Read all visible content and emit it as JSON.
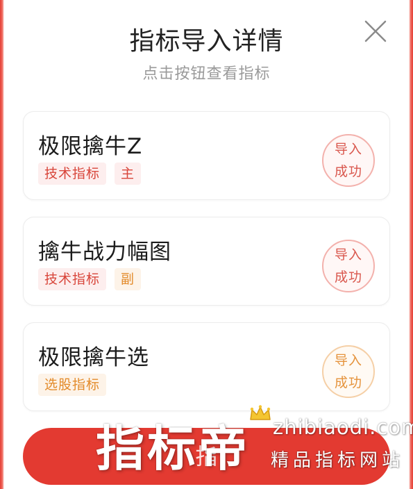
{
  "modal": {
    "title": "指标导入详情",
    "subtitle": "点击按钮查看指标",
    "close_icon": "close-icon"
  },
  "indicators": [
    {
      "name": "极限擒牛Z",
      "tags": [
        "技术指标",
        "主"
      ],
      "tag_colors": [
        "red",
        "red"
      ],
      "status_line1": "导入",
      "status_line2": "成功",
      "status_color": "red"
    },
    {
      "name": "擒牛战力幅图",
      "tags": [
        "技术指标",
        "副"
      ],
      "tag_colors": [
        "red",
        "orange"
      ],
      "status_line1": "导入",
      "status_line2": "成功",
      "status_color": "red"
    },
    {
      "name": "极限擒牛选",
      "tags": [
        "选股指标"
      ],
      "tag_colors": [
        "orange"
      ],
      "status_line1": "导入",
      "status_line2": "成功",
      "status_color": "orange"
    }
  ],
  "bottom_button": {
    "label": "指"
  },
  "watermark": {
    "brand": "指标帝",
    "site": "zhibiaodi.com",
    "slogan": "精品指标网站",
    "icon": "crown-icon"
  },
  "colors": {
    "accent_red": "#e33a31",
    "tag_red": "#d8453a",
    "tag_orange": "#e38b2b"
  }
}
